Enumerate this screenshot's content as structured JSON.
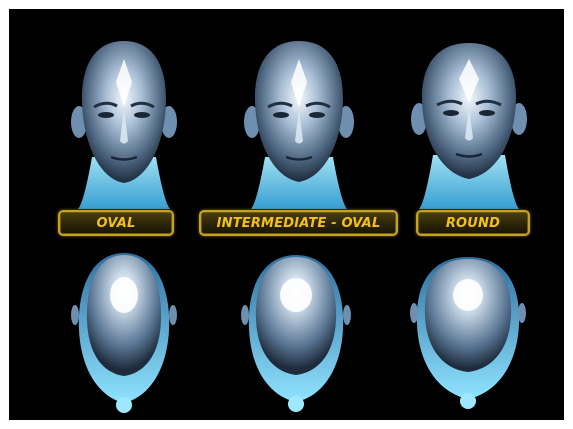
{
  "shapes": [
    {
      "label": "OVAL",
      "front_icon": "oval-face-front",
      "top_icon": "oval-head-top"
    },
    {
      "label": "INTERMEDIATE - OVAL",
      "front_icon": "intermediate-oval-face-front",
      "top_icon": "intermediate-oval-head-top"
    },
    {
      "label": "ROUND",
      "front_icon": "round-face-front",
      "top_icon": "round-head-top"
    }
  ],
  "colors": {
    "background": "#000000",
    "label_text": "#f2c21a",
    "label_border": "#c7a21c",
    "head_chrome": "#9fb6cf",
    "head_glow": "#6fd3f5"
  }
}
